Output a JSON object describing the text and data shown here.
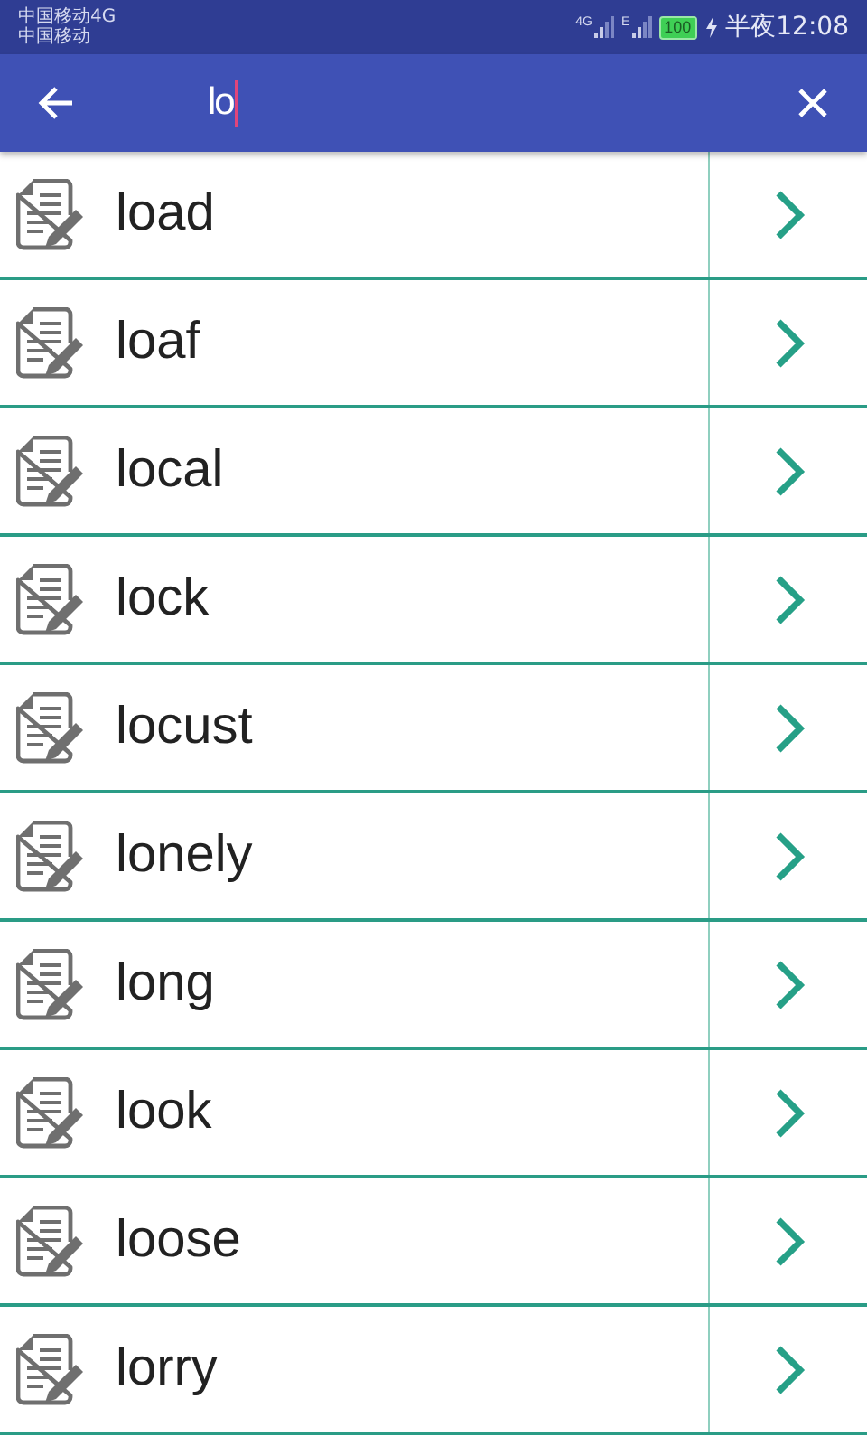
{
  "status_bar": {
    "carriers": [
      "中国移动4G",
      "中国移动"
    ],
    "signal_labels": [
      "4G",
      "E"
    ],
    "battery": "100",
    "time": "半夜12:08"
  },
  "search": {
    "value": "lo"
  },
  "results": [
    {
      "word": "load"
    },
    {
      "word": "loaf"
    },
    {
      "word": "local"
    },
    {
      "word": "lock"
    },
    {
      "word": "locust"
    },
    {
      "word": "lonely"
    },
    {
      "word": "long"
    },
    {
      "word": "look"
    },
    {
      "word": "loose"
    },
    {
      "word": "lorry"
    }
  ]
}
